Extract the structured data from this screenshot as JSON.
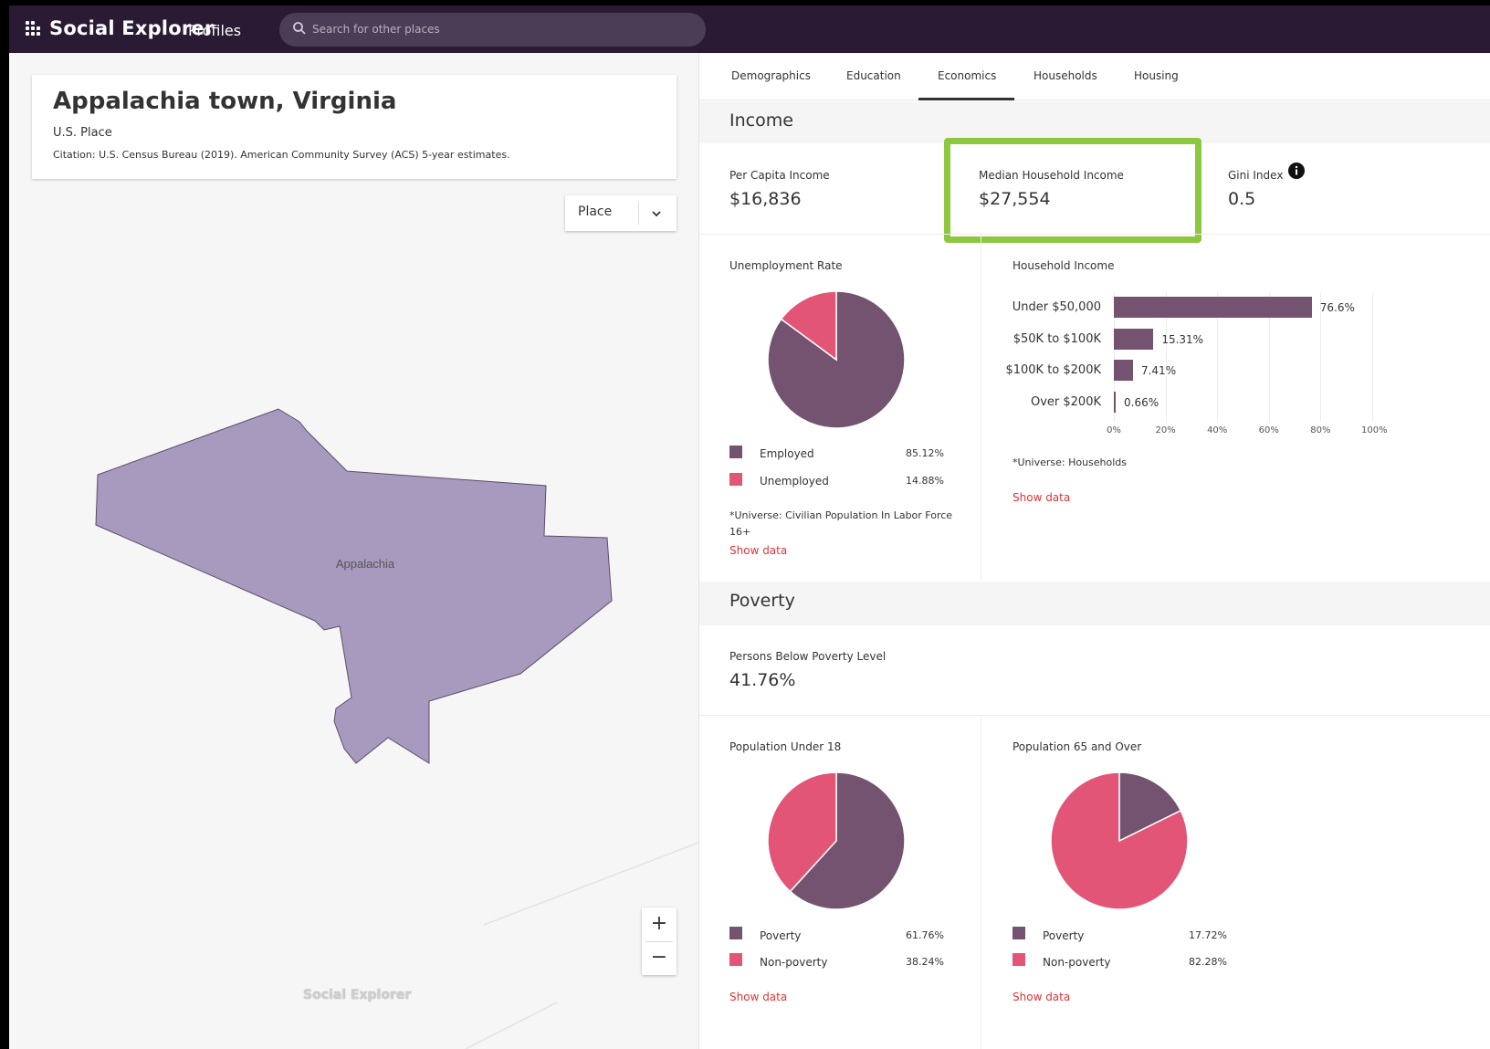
{
  "app": {
    "brand": "Social Explorer",
    "brand_sub": "Profiles",
    "search_placeholder": "Search for other places"
  },
  "place": {
    "title": "Appalachia town, Virginia",
    "type": "U.S. Place",
    "citation": "Citation: U.S. Census Bureau (2019). American Community Survey (ACS) 5-year estimates.",
    "level_select": "Place"
  },
  "map": {
    "label": "Appalachia",
    "zoom_in": "+",
    "zoom_out": "−",
    "watermark": "Social Explorer",
    "fill_color": "#a899bf"
  },
  "tabs": [
    "Demographics",
    "Education",
    "Economics",
    "Households",
    "Housing"
  ],
  "active_tab": "Economics",
  "income": {
    "section": "Income",
    "per_capita_label": "Per Capita Income",
    "per_capita_value": "$16,836",
    "median_label": "Median Household Income",
    "median_value": "$27,554",
    "gini_label": "Gini Index",
    "gini_value": "0.5"
  },
  "unemployment": {
    "title": "Unemployment Rate",
    "legend": [
      {
        "label": "Employed",
        "value": "85.12%"
      },
      {
        "label": "Unemployed",
        "value": "14.88%"
      }
    ],
    "note": "*Universe: Civilian Population In Labor Force 16+",
    "show_data": "Show data"
  },
  "household_income": {
    "title": "Household Income",
    "note": "*Universe: Households",
    "show_data": "Show data"
  },
  "poverty": {
    "section": "Poverty",
    "below_label": "Persons Below Poverty Level",
    "below_value": "41.76%",
    "under18": {
      "title": "Population Under 18",
      "legend": [
        {
          "label": "Poverty",
          "value": "61.76%"
        },
        {
          "label": "Non-poverty",
          "value": "38.24%"
        }
      ],
      "show_data": "Show data"
    },
    "over65": {
      "title": "Population 65 and Over",
      "legend": [
        {
          "label": "Poverty",
          "value": "17.72%"
        },
        {
          "label": "Non-poverty",
          "value": "82.28%"
        }
      ],
      "show_data": "Show data"
    }
  },
  "colors": {
    "primary": "#735370",
    "secondary": "#e35577",
    "highlight": "#8dc63f",
    "link": "#e03434",
    "topbar": "#2a1a34"
  },
  "chart_data": [
    {
      "type": "pie",
      "title": "Unemployment Rate",
      "categories": [
        "Employed",
        "Unemployed"
      ],
      "values": [
        85.12,
        14.88
      ]
    },
    {
      "type": "bar",
      "title": "Household Income",
      "orientation": "horizontal",
      "categories": [
        "Under $50,000",
        "$50K to $100K",
        "$100K to $200K",
        "Over $200K"
      ],
      "values": [
        76.6,
        15.31,
        7.41,
        0.66
      ],
      "value_labels": [
        "76.6%",
        "15.31%",
        "7.41%",
        "0.66%"
      ],
      "xlim": [
        0,
        100
      ],
      "xticks": [
        "0%",
        "20%",
        "40%",
        "60%",
        "80%",
        "100%"
      ],
      "grid": true
    },
    {
      "type": "pie",
      "title": "Population Under 18",
      "categories": [
        "Poverty",
        "Non-poverty"
      ],
      "values": [
        61.76,
        38.24
      ]
    },
    {
      "type": "pie",
      "title": "Population 65 and Over",
      "categories": [
        "Poverty",
        "Non-poverty"
      ],
      "values": [
        17.72,
        82.28
      ]
    }
  ]
}
